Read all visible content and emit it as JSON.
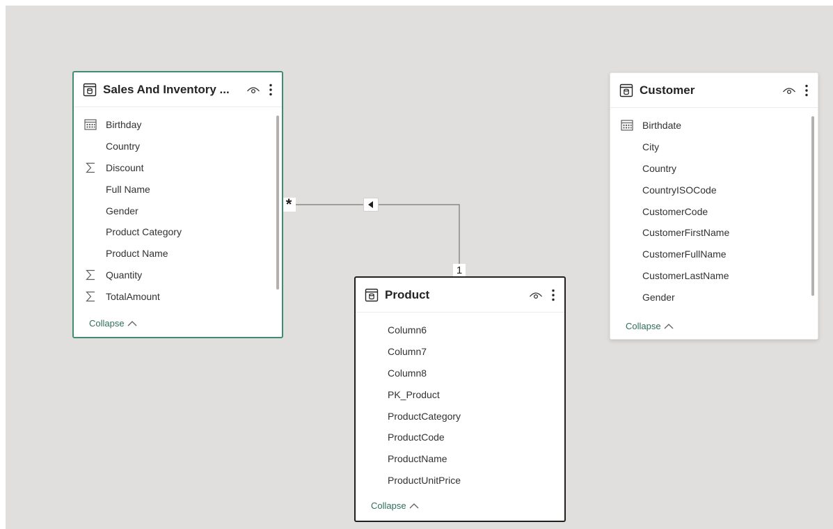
{
  "colors": {
    "canvas": "#e1dfdd",
    "selected_border": "#3f8c75",
    "focused_border": "#201f1e",
    "collapse_link": "#2f6e5d",
    "relationship_line": "#8a8886"
  },
  "relationship": {
    "from_cardinality": "*",
    "to_cardinality": "1",
    "direction_icon": "triangle-left-icon"
  },
  "tables": {
    "sales": {
      "title": "Sales And Inventory ...",
      "collapse_label": "Collapse",
      "fields": [
        {
          "label": "Birthday",
          "icon": "calendar-icon"
        },
        {
          "label": "Country",
          "icon": ""
        },
        {
          "label": "Discount",
          "icon": "sigma-icon"
        },
        {
          "label": "Full Name",
          "icon": ""
        },
        {
          "label": "Gender",
          "icon": ""
        },
        {
          "label": "Product Category",
          "icon": ""
        },
        {
          "label": "Product Name",
          "icon": ""
        },
        {
          "label": "Quantity",
          "icon": "sigma-icon"
        },
        {
          "label": "TotalAmount",
          "icon": "sigma-icon"
        }
      ]
    },
    "product": {
      "title": "Product",
      "collapse_label": "Collapse",
      "fields": [
        {
          "label": "Column6",
          "icon": ""
        },
        {
          "label": "Column7",
          "icon": ""
        },
        {
          "label": "Column8",
          "icon": ""
        },
        {
          "label": "PK_Product",
          "icon": ""
        },
        {
          "label": "ProductCategory",
          "icon": ""
        },
        {
          "label": "ProductCode",
          "icon": ""
        },
        {
          "label": "ProductName",
          "icon": ""
        },
        {
          "label": "ProductUnitPrice",
          "icon": ""
        }
      ]
    },
    "customer": {
      "title": "Customer",
      "collapse_label": "Collapse",
      "fields": [
        {
          "label": "Birthdate",
          "icon": "calendar-icon"
        },
        {
          "label": "City",
          "icon": ""
        },
        {
          "label": "Country",
          "icon": ""
        },
        {
          "label": "CountryISOCode",
          "icon": ""
        },
        {
          "label": "CustomerCode",
          "icon": ""
        },
        {
          "label": "CustomerFirstName",
          "icon": ""
        },
        {
          "label": "CustomerFullName",
          "icon": ""
        },
        {
          "label": "CustomerLastName",
          "icon": ""
        },
        {
          "label": "Gender",
          "icon": ""
        }
      ]
    }
  }
}
